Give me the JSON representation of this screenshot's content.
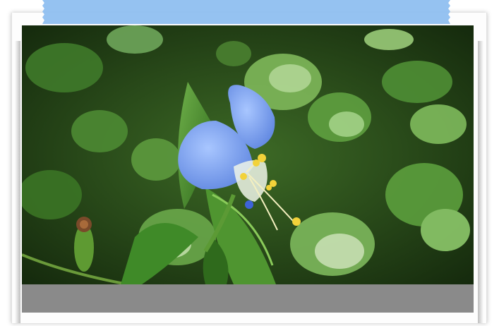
{
  "photo": {
    "subject": "blue-dayflower",
    "colors": {
      "tape": "#8fbff0",
      "petal": "#7ea6f0",
      "foliage_dark": "#1f3a14",
      "foliage_light": "#7fb85a",
      "caption_bar": "#8a8a8a"
    }
  },
  "caption": {
    "text": ""
  }
}
